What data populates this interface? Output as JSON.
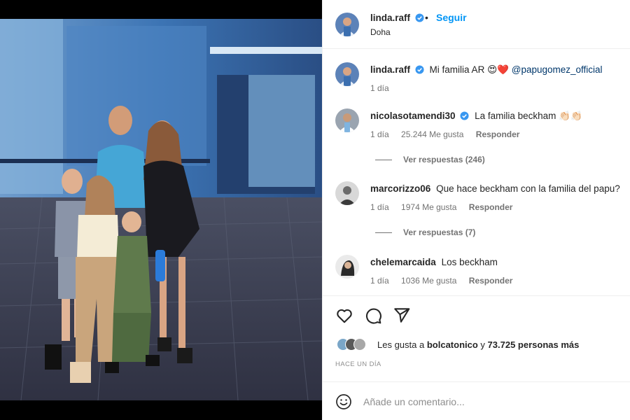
{
  "post": {
    "author": "linda.raff",
    "follow_label": "Seguir",
    "separator": "•",
    "location": "Doha"
  },
  "caption": {
    "username": "linda.raff",
    "text": "Mi familia AR",
    "emojis": "😍❤️",
    "mention": "@papugomez_official",
    "time": "1 día"
  },
  "comments": [
    {
      "username": "nicolasotamendi30",
      "verified": true,
      "text": "La familia beckham 👏🏻👏🏻",
      "time": "1 día",
      "likes": "25.244 Me gusta",
      "reply_label": "Responder",
      "view_replies": "Ver respuestas (246)"
    },
    {
      "username": "marcorizzo06",
      "verified": false,
      "text": "Que hace beckham con la familia del papu?",
      "time": "1 día",
      "likes": "1974 Me gusta",
      "reply_label": "Responder",
      "view_replies": "Ver respuestas (7)"
    },
    {
      "username": "chelemarcaida",
      "verified": false,
      "text": "Los beckham",
      "time": "1 día",
      "likes": "1036 Me gusta",
      "reply_label": "Responder"
    }
  ],
  "likes_summary": {
    "prefix": "Les gusta a",
    "liker": "bolcatonico",
    "middle": "y",
    "others": "73.725 personas más"
  },
  "timestamp": "HACE UN DÍA",
  "comment_box": {
    "placeholder": "Añade un comentario..."
  },
  "icons": {
    "like": "heart-icon",
    "comment": "comment-bubble-icon",
    "share": "paper-plane-icon",
    "emoji": "smiley-icon",
    "verified": "verified-badge-icon"
  },
  "colors": {
    "link_blue": "#0095f6",
    "verified_blue": "#3897f0",
    "highlight_red": "#c8102e",
    "text": "#262626",
    "muted": "#737373"
  }
}
